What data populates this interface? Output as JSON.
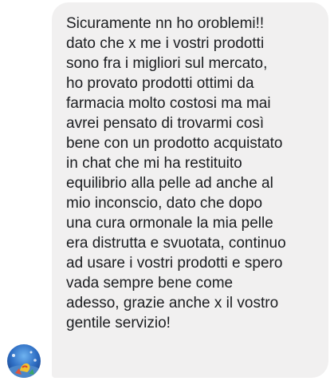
{
  "message": {
    "sender_avatar": "avatar-photo",
    "lines": [
      "Sicuramente nn ho oroblemi!!",
      "dato che x me i vostri prodotti",
      "sono fra i migliori sul mercato,",
      "ho provato prodotti ottimi da",
      "farmacia molto costosi ma mai",
      "avrei pensato di trovarmi così",
      "bene con un prodotto acquistato",
      "in chat che mi ha restituito",
      "equilibrio alla pelle ad anche al",
      "mio inconscio, dato che dopo",
      "una cura ormonale la mia pelle",
      "era distrutta e svuotata, continuo",
      "ad usare i vostri prodotti e spero",
      "vada sempre bene come",
      "adesso, grazie anche x il vostro",
      "gentile servizio!"
    ]
  },
  "colors": {
    "bubble_bg": "#f1f0f0",
    "text": "#1c1e21"
  }
}
